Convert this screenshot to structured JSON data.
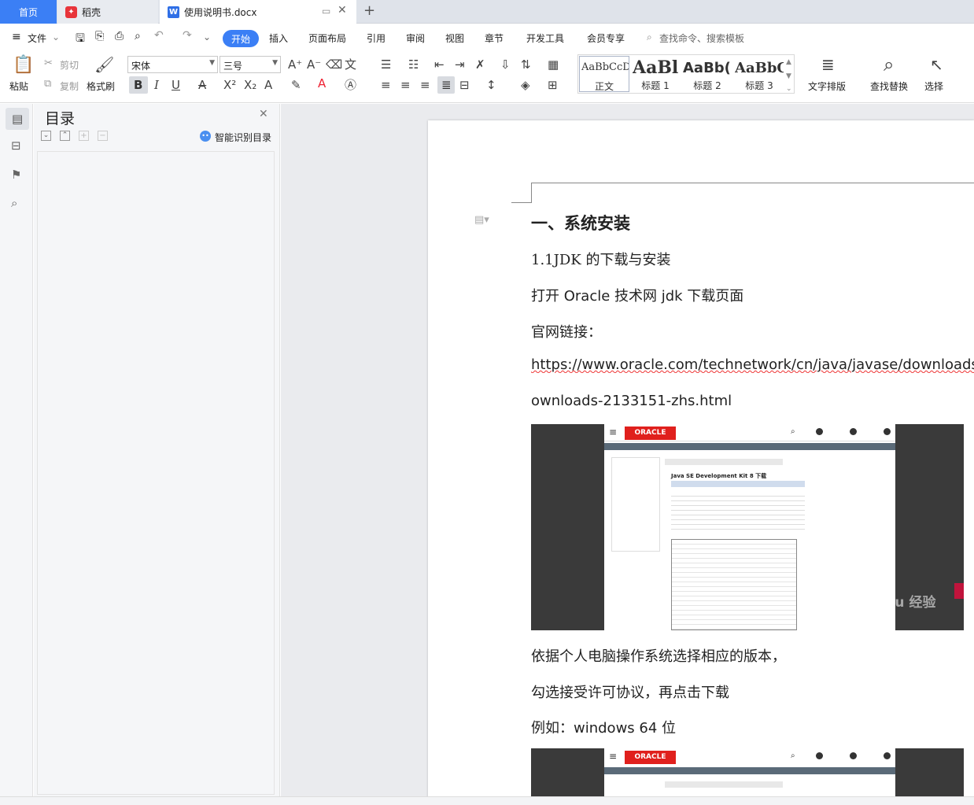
{
  "tabs": {
    "home": "首页",
    "daoke": "稻壳",
    "doc": "使用说明书.docx",
    "add": "+"
  },
  "menu": {
    "file": "文件",
    "items": [
      "开始",
      "插入",
      "页面布局",
      "引用",
      "审阅",
      "视图",
      "章节",
      "开发工具",
      "会员专享"
    ],
    "search": "查找命令、搜索模板"
  },
  "ribbon": {
    "paste": "粘贴",
    "cut": "剪切",
    "copy": "复制",
    "format_painter": "格式刷",
    "font": "宋体",
    "size": "三号",
    "styles": [
      {
        "preview": "AaBbCcDd",
        "label": "正文"
      },
      {
        "preview": "AaBl",
        "label": "标题 1"
      },
      {
        "preview": "AaBb(",
        "label": "标题 2"
      },
      {
        "preview": "AaBbC",
        "label": "标题 3"
      }
    ],
    "text_layout": "文字排版",
    "find_replace": "查找替换",
    "select": "选择"
  },
  "toc": {
    "title": "目录",
    "smart": "智能识别目录"
  },
  "doc": {
    "heading": "一、系统安装",
    "sub": "1.1JDK 的下载与安装",
    "p1": "打开 Oracle 技术网 jdk 下载页面",
    "p2": "官网链接：",
    "url1": "https://www.oracle.com/technetwork/cn/java/javase/downloads/jd",
    "url2": "ownloads-2133151-zhs.html",
    "p3": "依据个人电脑操作系统选择相应的版本，",
    "p4": " 勾选接受许可协议，再点击下载",
    "p5": "例如：windows   64 位"
  },
  "screenshot": {
    "brand": "ORACLE",
    "title": "Java SE Development Kit 8 下载",
    "watermark": "Baidu 经验"
  }
}
